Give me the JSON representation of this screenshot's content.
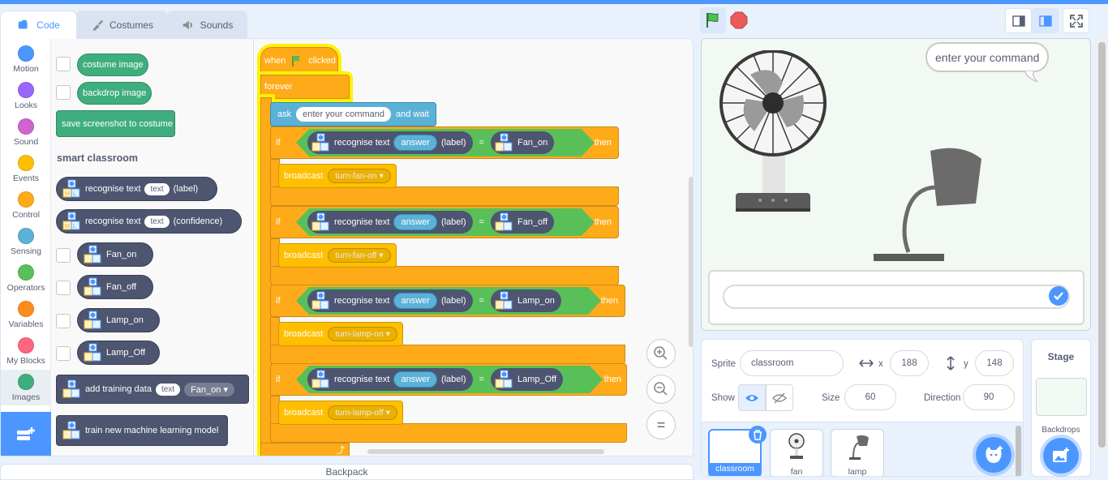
{
  "tabs": [
    {
      "label": "Code"
    },
    {
      "label": "Costumes"
    },
    {
      "label": "Sounds"
    }
  ],
  "categories": [
    {
      "label": "Motion",
      "color": "#4c97ff"
    },
    {
      "label": "Looks",
      "color": "#9966ff"
    },
    {
      "label": "Sound",
      "color": "#cf63cf"
    },
    {
      "label": "Events",
      "color": "#ffbf00"
    },
    {
      "label": "Control",
      "color": "#ffab19"
    },
    {
      "label": "Sensing",
      "color": "#5cb1d6"
    },
    {
      "label": "Operators",
      "color": "#59c059"
    },
    {
      "label": "Variables",
      "color": "#ff8c1a"
    },
    {
      "label": "My Blocks",
      "color": "#ff6680"
    },
    {
      "label": "Images",
      "color": "#3fae7f"
    }
  ],
  "palette": {
    "costume_image": "costume image",
    "backdrop_image": "backdrop image",
    "save_screenshot": "save screenshot to costume",
    "section": "smart classroom",
    "recognise_label": {
      "a": "recognise text",
      "b": "text",
      "c": "(label)"
    },
    "recognise_conf": {
      "a": "recognise text",
      "b": "text",
      "c": "(confidence)"
    },
    "labels": [
      "Fan_on",
      "Fan_off",
      "Lamp_on",
      "Lamp_Off"
    ],
    "add_training": {
      "a": "add training data",
      "b": "text",
      "c": "Fan_on"
    },
    "train": "train new machine learning model"
  },
  "script": {
    "when": "when",
    "clicked": "clicked",
    "forever": "forever",
    "ask": "ask",
    "ask_text": "enter your command",
    "and_wait": "and wait",
    "if": "if",
    "then": "then",
    "recognise": "recognise text",
    "answer": "answer",
    "label": "(label)",
    "eq": "=",
    "broadcast": "broadcast",
    "conds": [
      "Fan_on",
      "Fan_off",
      "Lamp_on",
      "Lamp_Off"
    ],
    "messages": [
      "turn-fan-on",
      "turn-fan-off",
      "turn-lamp-on",
      "turn-lamp-off"
    ]
  },
  "zoom": {
    "reset": "="
  },
  "backpack": "Backpack",
  "stage": {
    "bubble": "enter your command"
  },
  "sprite_info": {
    "sprite_label": "Sprite",
    "sprite_name": "classroom",
    "x_label": "x",
    "x": "188",
    "y_label": "y",
    "y": "148",
    "show_label": "Show",
    "size_label": "Size",
    "size": "60",
    "direction_label": "Direction",
    "direction": "90"
  },
  "sprite_tiles": [
    {
      "name": "classroom"
    },
    {
      "name": "fan"
    },
    {
      "name": "lamp"
    }
  ],
  "stage_panel": {
    "title": "Stage",
    "backdrops": "Backdrops"
  }
}
